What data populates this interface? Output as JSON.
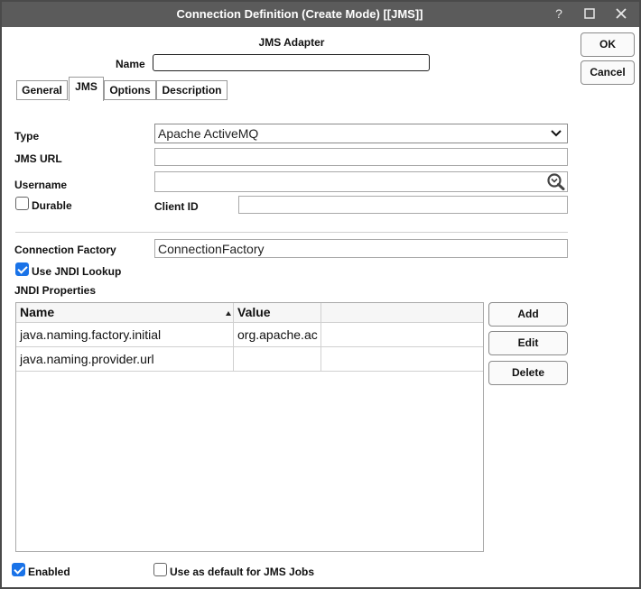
{
  "window": {
    "title": "Connection Definition (Create Mode) [[JMS]]",
    "help_glyph": "?",
    "maximize_glyph": "☐",
    "close_glyph": "✕"
  },
  "buttons": {
    "ok": "OK",
    "cancel": "Cancel"
  },
  "header": {
    "adapter": "JMS Adapter",
    "name_label": "Name",
    "name_value": ""
  },
  "tabs": [
    {
      "label": "General",
      "active": false
    },
    {
      "label": "JMS",
      "active": true
    },
    {
      "label": "Options",
      "active": false
    },
    {
      "label": "Description",
      "active": false
    }
  ],
  "form": {
    "type_label": "Type",
    "type_value": "Apache ActiveMQ",
    "jms_url_label": "JMS URL",
    "jms_url_value": "",
    "username_label": "Username",
    "username_value": "",
    "username_lookup_icon": "search-icon",
    "durable_label": "Durable",
    "durable_checked": false,
    "client_id_label": "Client ID",
    "client_id_value": "",
    "connection_factory_label": "Connection Factory",
    "connection_factory_value": "ConnectionFactory",
    "use_jndi_label": "Use JNDI Lookup",
    "use_jndi_checked": true,
    "jndi_properties_label": "JNDI Properties"
  },
  "jndi_table": {
    "columns": [
      "Name",
      "Value"
    ],
    "rows": [
      {
        "name": "java.naming.factory.initial",
        "value": "org.apache.ac"
      },
      {
        "name": "java.naming.provider.url",
        "value": ""
      }
    ]
  },
  "table_actions": {
    "add": "Add",
    "edit": "Edit",
    "delete": "Delete"
  },
  "footer": {
    "enabled_label": "Enabled",
    "enabled_checked": true,
    "default_label": "Use as default for JMS Jobs",
    "default_checked": false
  },
  "colors": {
    "titlebar": "#5b5b5b",
    "accent": "#1a73e8"
  }
}
